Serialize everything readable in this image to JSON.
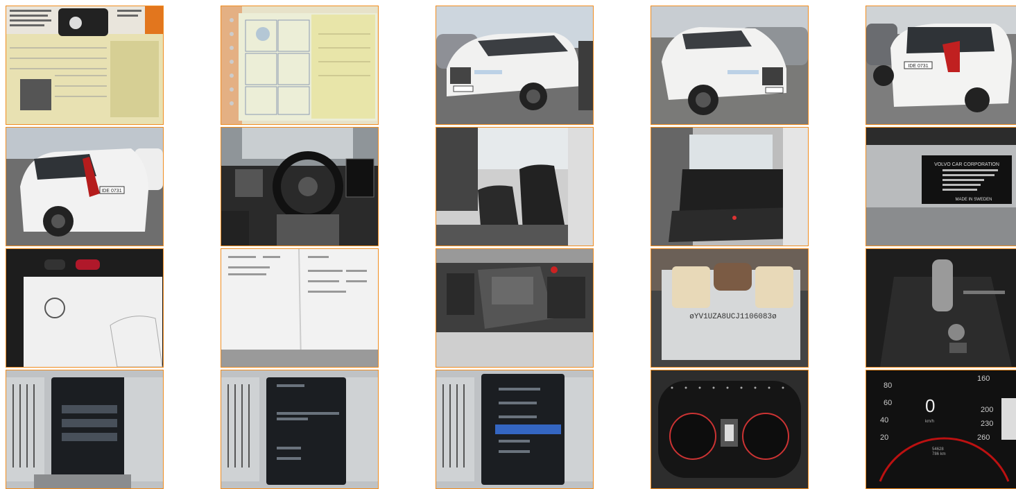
{
  "gallery": {
    "border_color": "#f08c1e",
    "photos": [
      {
        "id": "doc-with-key",
        "row": 1,
        "col": 1
      },
      {
        "id": "doc-registration",
        "row": 1,
        "col": 2
      },
      {
        "id": "front-left",
        "row": 1,
        "col": 3
      },
      {
        "id": "front-right",
        "row": 1,
        "col": 4
      },
      {
        "id": "rear-right",
        "row": 1,
        "col": 5
      },
      {
        "id": "rear-left",
        "row": 2,
        "col": 1
      },
      {
        "id": "dashboard",
        "row": 2,
        "col": 2
      },
      {
        "id": "front-seats",
        "row": 2,
        "col": 3
      },
      {
        "id": "rear-seats",
        "row": 2,
        "col": 4
      },
      {
        "id": "vin-plate",
        "row": 2,
        "col": 5
      },
      {
        "id": "key-and-manual",
        "row": 3,
        "col": 1
      },
      {
        "id": "manual-pages",
        "row": 3,
        "col": 2
      },
      {
        "id": "engine-bay",
        "row": 3,
        "col": 3
      },
      {
        "id": "vin-stamp",
        "row": 3,
        "col": 4
      },
      {
        "id": "gear-shifter",
        "row": 3,
        "col": 5
      },
      {
        "id": "center-screen-1",
        "row": 4,
        "col": 1
      },
      {
        "id": "center-screen-2",
        "row": 4,
        "col": 2
      },
      {
        "id": "center-screen-3",
        "row": 4,
        "col": 3
      },
      {
        "id": "instrument-cluster",
        "row": 4,
        "col": 4
      },
      {
        "id": "speedometer",
        "row": 4,
        "col": 5
      }
    ],
    "texts": {
      "plate_rear": "IDE 0731",
      "plate_rear_left": "IDE 0731",
      "vin_plate_header": "VOLVO CAR CORPORATION",
      "vin_plate_footer": "MADE IN SWEDEN",
      "vin_stamp": "øYV1UZA8UCJ1106083ø",
      "speed_value": "0",
      "speed_unit": "km/h",
      "speed_ticks": [
        "80",
        "60",
        "40",
        "20",
        "160",
        "200",
        "230",
        "260"
      ],
      "cluster_values": [
        "54628",
        "786 km"
      ]
    }
  }
}
